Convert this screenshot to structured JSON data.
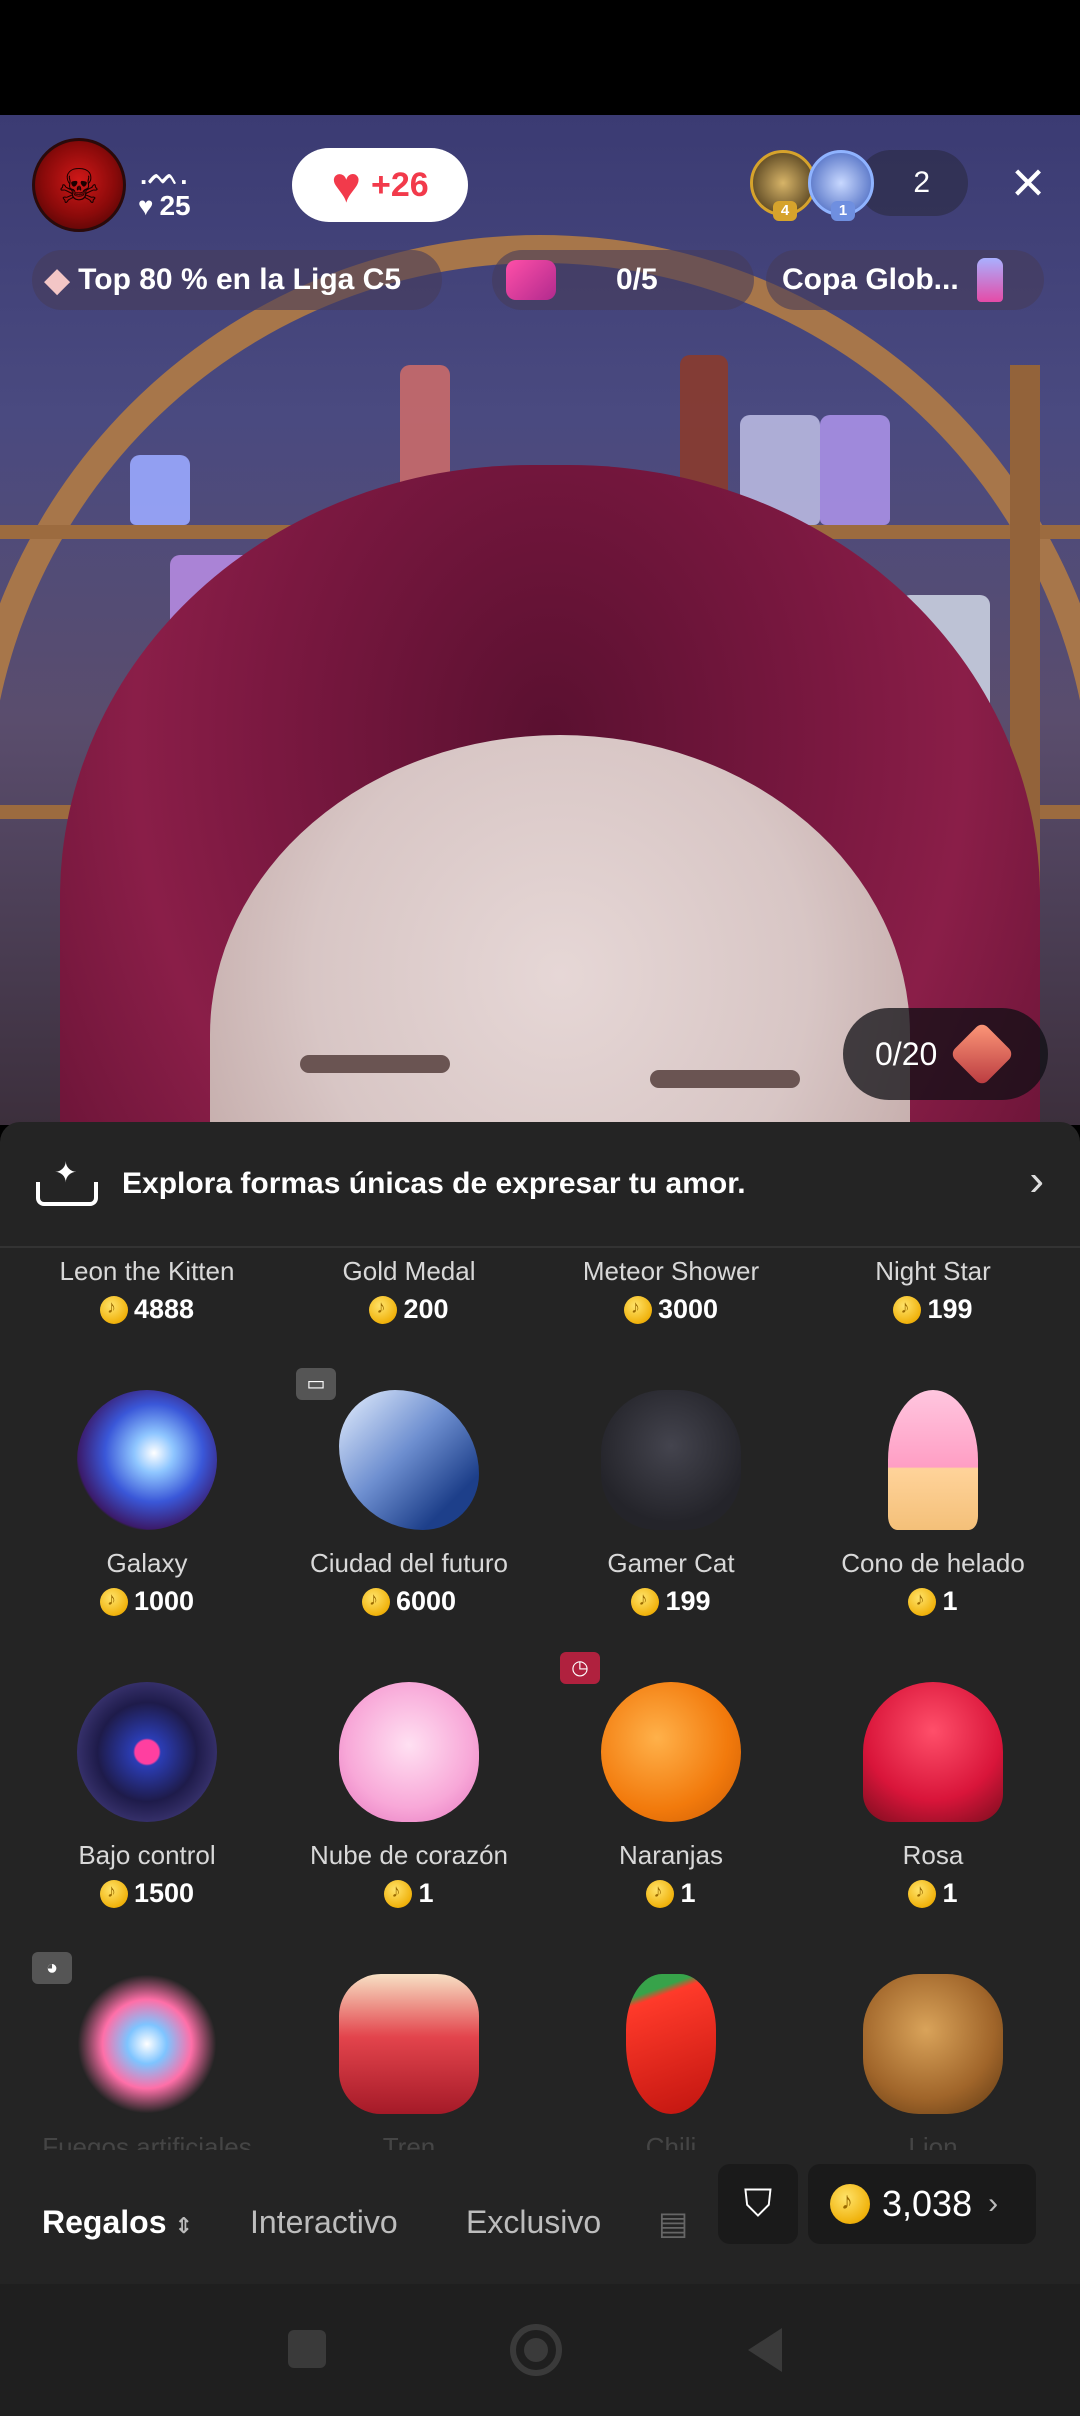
{
  "host": {
    "name": ".ᨓ.",
    "likes": "25"
  },
  "like_pill": {
    "value": "+26"
  },
  "viewers": {
    "badges": [
      "4",
      "1"
    ],
    "count": "2"
  },
  "chips": {
    "league": "Top 80 % en la Liga C5",
    "goal": "0/5",
    "cup": "Copa Glob..."
  },
  "counter": "0/20",
  "banner": {
    "text": "Explora formas únicas de expresar tu amor."
  },
  "top_row": [
    {
      "name": "Leon the Kitten",
      "price": "4888"
    },
    {
      "name": "Gold Medal",
      "price": "200"
    },
    {
      "name": "Meteor Shower",
      "price": "3000"
    },
    {
      "name": "Night Star",
      "price": "199"
    }
  ],
  "gifts": [
    {
      "name": "Galaxy",
      "price": "1000",
      "icon": "galaxy"
    },
    {
      "name": "Ciudad del futuro",
      "price": "6000",
      "icon": "city"
    },
    {
      "name": "Gamer Cat",
      "price": "199",
      "icon": "cat"
    },
    {
      "name": "Cono de helado",
      "price": "1",
      "icon": "cone"
    },
    {
      "name": "Bajo control",
      "price": "1500",
      "icon": "bajo"
    },
    {
      "name": "Nube de corazón",
      "price": "1",
      "icon": "nube"
    },
    {
      "name": "Naranjas",
      "price": "1",
      "icon": "naranjas"
    },
    {
      "name": "Rosa",
      "price": "1",
      "icon": "rosa"
    },
    {
      "name": "Fuegos artificiales",
      "price": "",
      "icon": "fuegos"
    },
    {
      "name": "Tren",
      "price": "",
      "icon": "tren"
    },
    {
      "name": "Chili",
      "price": "",
      "icon": "chili"
    },
    {
      "name": "Lion",
      "price": "",
      "icon": "leon"
    }
  ],
  "tabs": {
    "regalos": "Regalos",
    "interactivo": "Interactivo",
    "exclusivo": "Exclusivo"
  },
  "balance": "3,038",
  "colors": {
    "accent_red": "#f23a4b",
    "coin_gold": "#f0b20c",
    "panel_bg": "#242424"
  }
}
